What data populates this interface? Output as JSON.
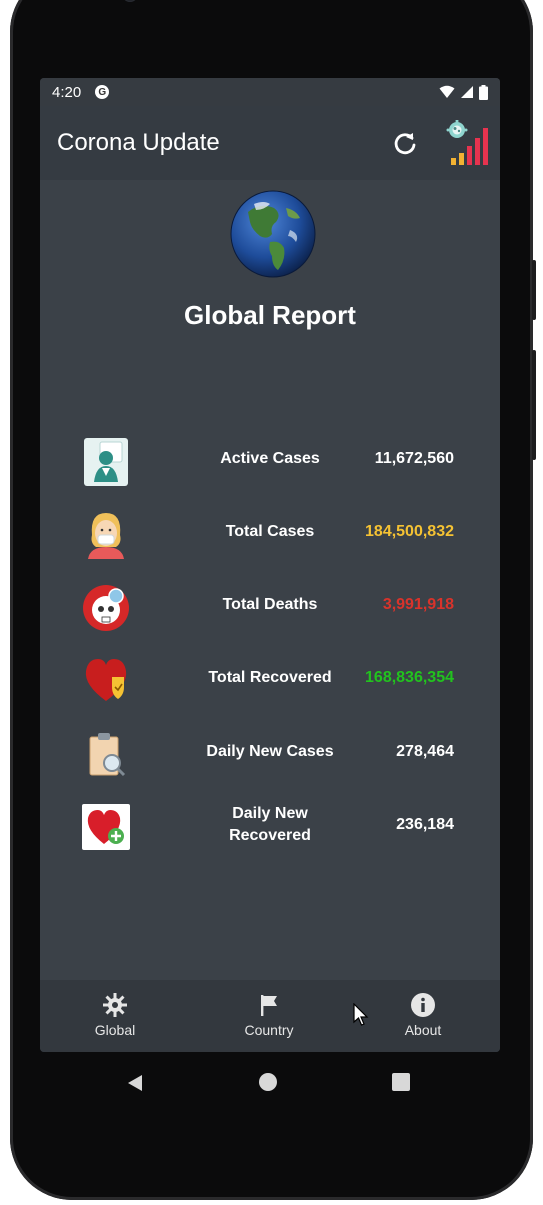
{
  "status": {
    "time": "4:20",
    "notification_badge": "G"
  },
  "appbar": {
    "title": "Corona Update"
  },
  "report": {
    "title": "Global Report"
  },
  "stats": [
    {
      "label": "Active Cases",
      "value": "11,672,560",
      "color": "#ffffff",
      "icon": "doctor-icon"
    },
    {
      "label": "Total Cases",
      "value": "184,500,832",
      "color": "#f5c233",
      "icon": "patient-mask-icon"
    },
    {
      "label": "Total Deaths",
      "value": "3,991,918",
      "color": "#d9332b",
      "icon": "skull-virus-icon"
    },
    {
      "label": "Total Recovered",
      "value": "168,836,354",
      "color": "#22c21e",
      "icon": "heart-shield-icon"
    },
    {
      "label": "Daily New Cases",
      "value": "278,464",
      "color": "#ffffff",
      "icon": "clipboard-search-icon"
    },
    {
      "label": "Daily New Recovered",
      "value": "236,184",
      "color": "#ffffff",
      "icon": "heart-plus-icon"
    }
  ],
  "nav": {
    "global": "Global",
    "country": "Country",
    "about": "About"
  },
  "colors": {
    "screen_bg": "#3b4148",
    "appbar_bg": "#353b42",
    "navbar_bg": "#33383e"
  }
}
